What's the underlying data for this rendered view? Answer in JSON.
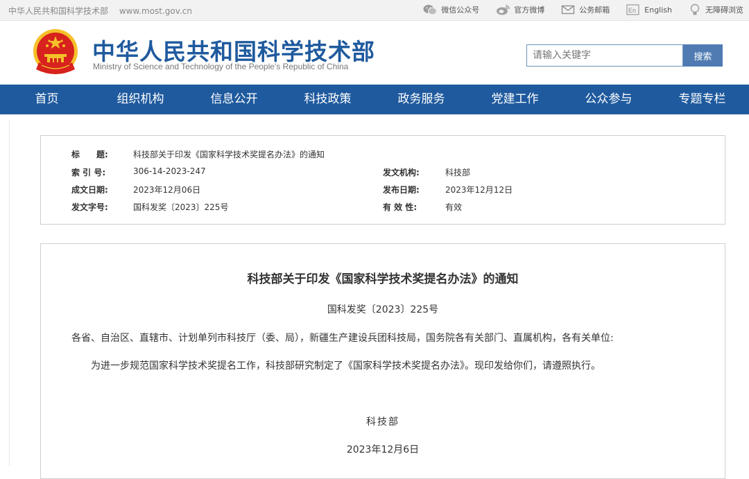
{
  "topbar": {
    "site_name": "中华人民共和国科学技术部",
    "site_url": "www.most.gov.cn",
    "links": [
      "微信公众号",
      "官方微博",
      "公务邮箱",
      "English",
      "无障碍浏览"
    ]
  },
  "header": {
    "title_cn": "中华人民共和国科学技术部",
    "title_en": "Ministry of Science and Technology of the People's Republic of China",
    "search_placeholder": "请输入关键字",
    "search_button": "搜索"
  },
  "nav": [
    "首页",
    "组织机构",
    "信息公开",
    "科技政策",
    "政务服务",
    "党建工作",
    "公众参与",
    "专题专栏"
  ],
  "meta": {
    "title_label": "标　　题:",
    "title_value": "科技部关于印发《国家科学技术奖提名办法》的通知",
    "index_label": "索 引 号:",
    "index_value": "306-14-2023-247",
    "issuer_label": "发文机构:",
    "issuer_value": "科技部",
    "created_label": "成文日期:",
    "created_value": "2023年12月06日",
    "published_label": "发布日期:",
    "published_value": "2023年12月12日",
    "docno_label": "发文字号:",
    "docno_value": "国科发奖〔2023〕225号",
    "validity_label": "有 效 性:",
    "validity_value": "有效"
  },
  "document": {
    "title": "科技部关于印发《国家科学技术奖提名办法》的通知",
    "number": "国科发奖〔2023〕225号",
    "recipient": "各省、自治区、直辖市、计划单列市科技厅（委、局），新疆生产建设兵团科技局，国务院各有关部门、直属机构，各有关单位:",
    "body": "为进一步规范国家科学技术奖提名工作，科技部研究制定了《国家科学技术奖提名办法》。现印发给你们，请遵照执行。",
    "signature": "科技部",
    "date": "2023年12月6日"
  },
  "colors": {
    "brand_blue": "#1f5a9e",
    "button_blue": "#4f7bb2",
    "emblem_red": "#d7221d",
    "emblem_gold": "#f5c02a"
  },
  "icons": [
    "wechat-icon",
    "weibo-icon",
    "mail-icon",
    "english-icon",
    "accessibility-icon",
    "national-emblem"
  ]
}
